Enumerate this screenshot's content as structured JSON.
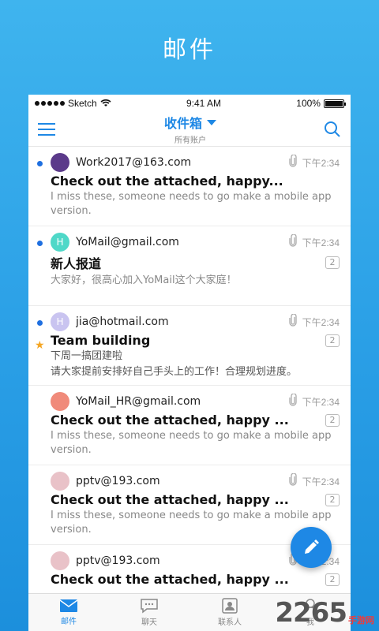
{
  "banner_title": "邮件",
  "status_bar": {
    "carrier": "Sketch",
    "time": "9:41 AM",
    "battery": "100%",
    "battery_level": 1.0
  },
  "nav": {
    "title": "收件箱",
    "subtitle": "所有账户"
  },
  "mails": [
    {
      "sender": "Work2017@163.com",
      "time": "下午2:34",
      "subject": "Check out the attached, happy...",
      "preview": "I miss these, someone needs to go make a mobile app version.",
      "unread": true,
      "starred": false,
      "count": "",
      "avatar_color": "#5b3a8a",
      "avatar_letter": ""
    },
    {
      "sender": "YoMail@gmail.com",
      "time": "下午2:34",
      "subject": "新人报道",
      "preview": "大家好，很高心加入YoMail这个大家庭！",
      "unread": true,
      "starred": false,
      "count": "2",
      "avatar_color": "#4fd8c8",
      "avatar_letter": "H"
    },
    {
      "sender": "jia@hotmail.com",
      "time": "下午2:34",
      "subject": "Team building",
      "preview_line1": "下周一搞团建啦",
      "preview": "请大家提前安排好自己手头上的工作！合理规划进度。",
      "unread": true,
      "starred": true,
      "count": "2",
      "avatar_color": "#c9c4f0",
      "avatar_letter": "H"
    },
    {
      "sender": "YoMail_HR@gmail.com",
      "time": "下午2:34",
      "subject": "Check out the attached, happy ...",
      "preview": "I miss these, someone needs to go make a mobile app version.",
      "unread": false,
      "starred": false,
      "count": "2",
      "avatar_color": "#f08a7a",
      "avatar_letter": ""
    },
    {
      "sender": "pptv@193.com",
      "time": "下午2:34",
      "subject": "Check out the attached, happy ...",
      "preview": "I miss these, someone needs to go make a mobile app version.",
      "unread": false,
      "starred": false,
      "count": "2",
      "avatar_color": "#e9c2c8",
      "avatar_letter": ""
    },
    {
      "sender": "pptv@193.com",
      "time": "下午2:34",
      "subject": "Check out the attached, happy ...",
      "preview": "",
      "unread": false,
      "starred": false,
      "count": "2",
      "avatar_color": "#e9c2c8",
      "avatar_letter": ""
    }
  ],
  "tabs": [
    {
      "label": "邮件",
      "icon": "mail-icon",
      "active": true
    },
    {
      "label": "聊天",
      "icon": "chat-icon",
      "active": false
    },
    {
      "label": "联系人",
      "icon": "contacts-icon",
      "active": false
    },
    {
      "label": "我",
      "icon": "profile-icon",
      "active": false
    }
  ],
  "watermark": {
    "number": "2265",
    "text": "手游网"
  },
  "colors": {
    "accent": "#1e88e5",
    "background": "#2a9fe6",
    "star": "#f5a623",
    "unread_dot": "#1e6fe0"
  }
}
